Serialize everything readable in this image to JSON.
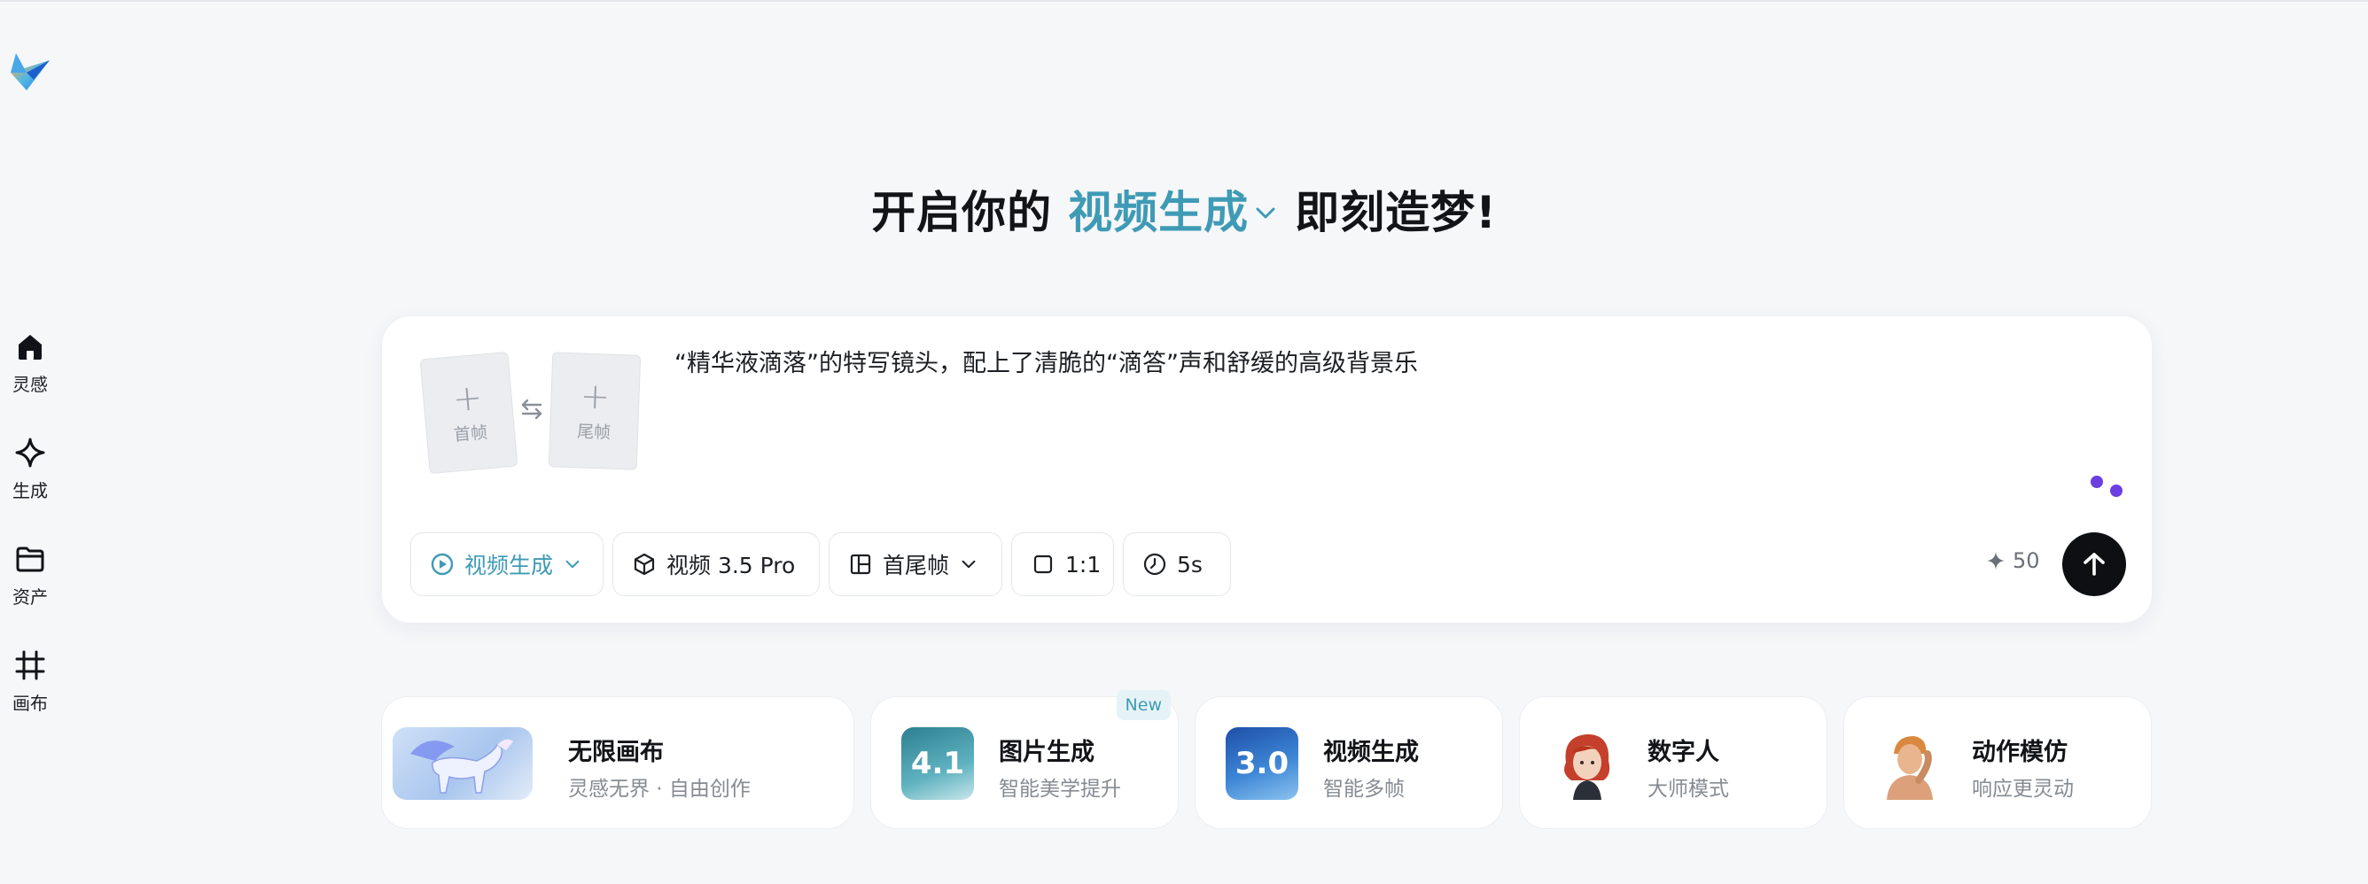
{
  "sidebar": {
    "logo_icon": "paper-plane-logo",
    "items": [
      {
        "label": "灵感",
        "icon": "home-icon"
      },
      {
        "label": "生成",
        "icon": "sparkle-icon"
      },
      {
        "label": "资产",
        "icon": "folder-icon"
      },
      {
        "label": "画布",
        "icon": "canvas-icon"
      }
    ]
  },
  "headline": {
    "prefix": "开启你的",
    "mode": "视频生成",
    "suffix": "即刻造梦!"
  },
  "prompt": {
    "first_frame_label": "首帧",
    "last_frame_label": "尾帧",
    "text": "“精华液滴落”的特写镜头，配上了清脆的“滴答”声和舒缓的高级背景乐"
  },
  "toolbar": {
    "mode_label": "视频生成",
    "model_label": "视频 3.5 Pro",
    "frame_mode_label": "首尾帧",
    "ratio_label": "1:1",
    "duration_label": "5s",
    "credits": "50"
  },
  "features": [
    {
      "title": "无限画布",
      "subtitle": "灵感无界 · 自由创作"
    },
    {
      "title": "图片生成",
      "subtitle": "智能美学提升",
      "badge": "New",
      "thumb_text": "4.1"
    },
    {
      "title": "视频生成",
      "subtitle": "智能多帧",
      "thumb_text": "3.0"
    },
    {
      "title": "数字人",
      "subtitle": "大师模式"
    },
    {
      "title": "动作模仿",
      "subtitle": "响应更灵动"
    }
  ],
  "colors": {
    "accent": "#3f9bb5",
    "background": "#f6f7f9",
    "send_button": "#0d0f12",
    "dots": "#6b3fe0"
  }
}
